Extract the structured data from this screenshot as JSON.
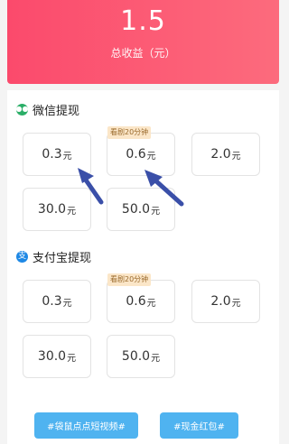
{
  "header": {
    "total_value": "1.5",
    "total_label": "总收益（元）"
  },
  "wechat": {
    "title": "微信提现",
    "icon": "wechat-icon",
    "options": [
      {
        "amount": "0.3",
        "unit": "元",
        "tag": ""
      },
      {
        "amount": "0.6",
        "unit": "元",
        "tag": "看剧20分钟"
      },
      {
        "amount": "2.0",
        "unit": "元",
        "tag": ""
      },
      {
        "amount": "30.0",
        "unit": "元",
        "tag": ""
      },
      {
        "amount": "50.0",
        "unit": "元",
        "tag": ""
      }
    ]
  },
  "alipay": {
    "title": "支付宝提现",
    "icon": "alipay-icon",
    "options": [
      {
        "amount": "0.3",
        "unit": "元",
        "tag": ""
      },
      {
        "amount": "0.6",
        "unit": "元",
        "tag": "看剧20分钟"
      },
      {
        "amount": "2.0",
        "unit": "元",
        "tag": ""
      },
      {
        "amount": "30.0",
        "unit": "元",
        "tag": ""
      },
      {
        "amount": "50.0",
        "unit": "元",
        "tag": ""
      }
    ]
  },
  "buttons": {
    "left_label": "#袋鼠点点短视频#",
    "right_label": "#现金红包#"
  },
  "colors": {
    "header_start": "#fb4a6c",
    "header_end": "#fc6b7d",
    "button": "#4fb3f0",
    "tag_bg": "#fbe6c8",
    "arrow": "#3a4fa8"
  }
}
